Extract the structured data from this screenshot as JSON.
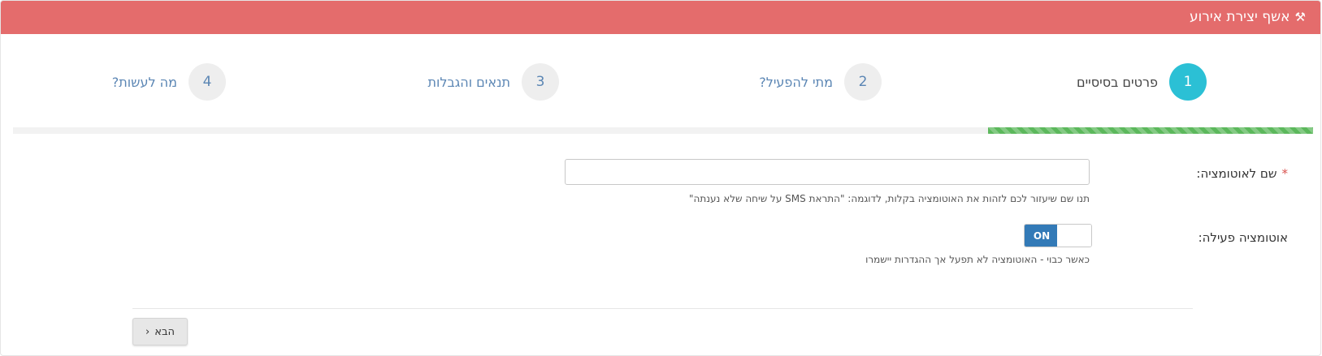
{
  "header": {
    "title": "אשף יצירת אירוע",
    "icon": "magic-wand-icon"
  },
  "steps": [
    {
      "number": "1",
      "label": "פרטים בסיסיים",
      "active": true
    },
    {
      "number": "2",
      "label": "מתי להפעיל?",
      "active": false
    },
    {
      "number": "3",
      "label": "תנאים והגבלות",
      "active": false
    },
    {
      "number": "4",
      "label": "מה לעשות?",
      "active": false
    }
  ],
  "progress": {
    "completed_fraction": 0.25,
    "color": "#5cb85c"
  },
  "form": {
    "name": {
      "label": "שם לאוטומציה:",
      "required_mark": "*",
      "value": "",
      "hint": "תנו שם שיעזור לכם לזהות את האוטומציה בקלות, לדוגמה: \"התראת SMS על שיחה שלא נענתה\""
    },
    "active": {
      "label": "אוטומציה פעילה:",
      "toggle_label": "ON",
      "state": "on",
      "hint": "כאשר כבוי - האוטומציה לא תפעל אך ההגדרות יישמרו"
    }
  },
  "footer": {
    "next_label": "הבא",
    "next_icon": "chevron-right-icon"
  },
  "colors": {
    "header": "#e46c6c",
    "active_step": "#2bc0d5",
    "toggle_on": "#337ab7"
  }
}
